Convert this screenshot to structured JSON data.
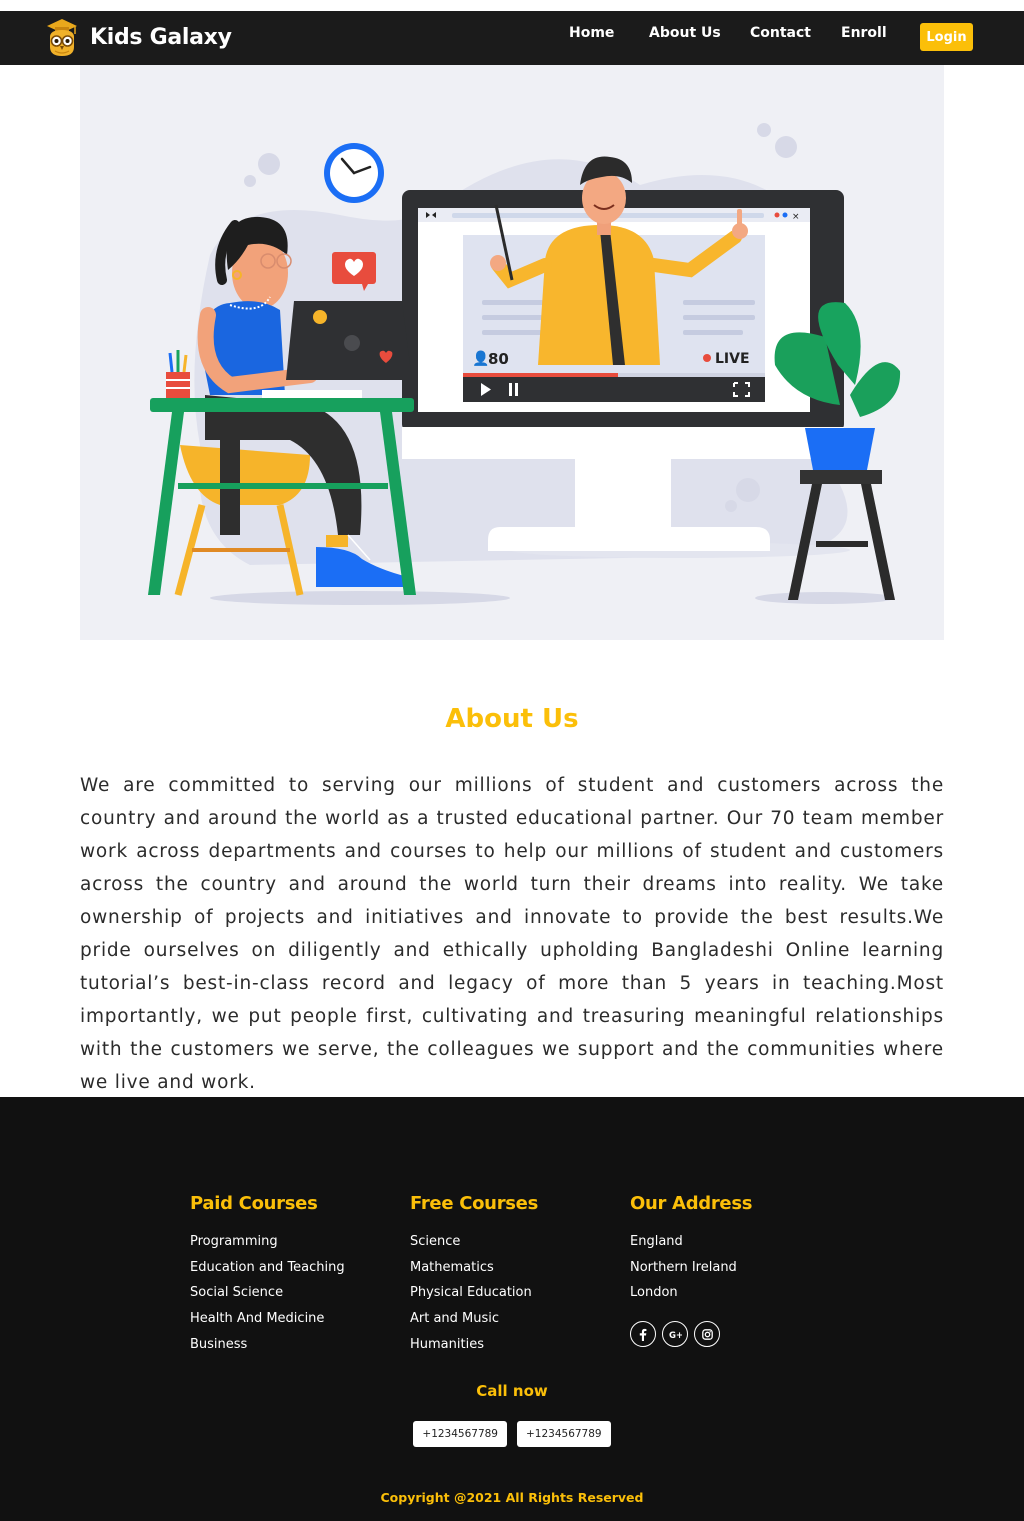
{
  "colors": {
    "accent": "#fbbf09",
    "navbar_bg": "#1b1b1b",
    "footer_bg": "#111111",
    "hero_bg": "#eff0f5"
  },
  "navbar": {
    "brand": "Kids Galaxy",
    "logo_icon": "owl-graduation-icon",
    "links": [
      "Home",
      "About Us",
      "Contact",
      "Enroll"
    ],
    "login": "Login"
  },
  "hero": {
    "illustration": "online-learning-illustration",
    "viewer_count": "80",
    "live_label": "LIVE"
  },
  "about": {
    "title": "About Us",
    "text": "We are committed to serving our millions of student and customers across the country and around the world as a trusted educational partner. Our 70 team member work across departments and courses to help our millions of student and customers across the country and around the world turn their dreams into reality. We take ownership of projects and initiatives and innovate to provide the best results.We pride ourselves on diligently and ethically upholding Bangladeshi Online learning tutorial’s best-in-class record and legacy of more than 5 years in teaching.Most importantly, we put people first, cultivating and treasuring meaningful relationships with the customers we serve, the colleagues we support and the communities where we live and work."
  },
  "footer": {
    "paid": {
      "title": "Paid Courses",
      "items": [
        "Programming",
        "Education and Teaching",
        "Social Science",
        "Health And Medicine",
        "Business"
      ]
    },
    "free": {
      "title": "Free Courses",
      "items": [
        "Science",
        "Mathematics",
        "Physical Education",
        "Art and Music",
        "Humanities"
      ]
    },
    "address": {
      "title": "Our Address",
      "items": [
        "England",
        "Northern Ireland",
        "London"
      ]
    },
    "socials": [
      "facebook-icon",
      "google-plus-icon",
      "instagram-icon"
    ],
    "call_title": "Call now",
    "phones": [
      "+1234567789",
      "+1234567789"
    ],
    "copyright": "Copyright @2021 All Rights Reserved"
  }
}
